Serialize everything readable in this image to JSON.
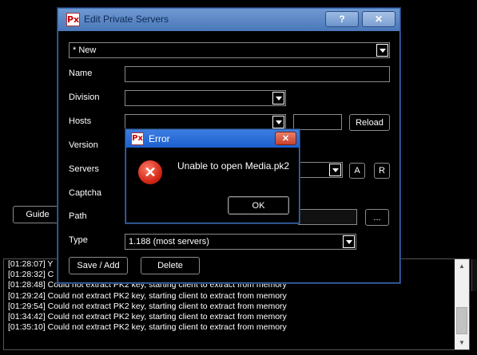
{
  "background": {
    "guide_label": "Guide",
    "log_lines": [
      "[01:28:07] Y",
      "[01:28:32] C",
      "[01:28:48] Could not extract PK2 key, starting client to extract from memory",
      "[01:29:24] Could not extract PK2 key, starting client to extract from memory",
      "[01:29:54] Could not extract PK2 key, starting client to extract from memory",
      "[01:34:42] Could not extract PK2 key, starting client to extract from memory",
      "[01:35:10] Could not extract PK2 key, starting client to extract from memory"
    ]
  },
  "dialog": {
    "title": "Edit Private Servers",
    "help_label": "?",
    "close_label": "✕",
    "server_select": "* New",
    "labels": {
      "name": "Name",
      "division": "Division",
      "hosts": "Hosts",
      "version": "Version",
      "servers": "Servers",
      "captcha": "Captcha",
      "path": "Path",
      "type": "Type"
    },
    "reload_label": "Reload",
    "a_label": "A",
    "r_label": "R",
    "browse_label": "...",
    "type_value": "1.188 (most servers)",
    "save_label": "Save / Add",
    "delete_label": "Delete"
  },
  "error": {
    "title": "Error",
    "close_label": "✕",
    "message": "Unable to open Media.pk2",
    "ok_label": "OK"
  }
}
